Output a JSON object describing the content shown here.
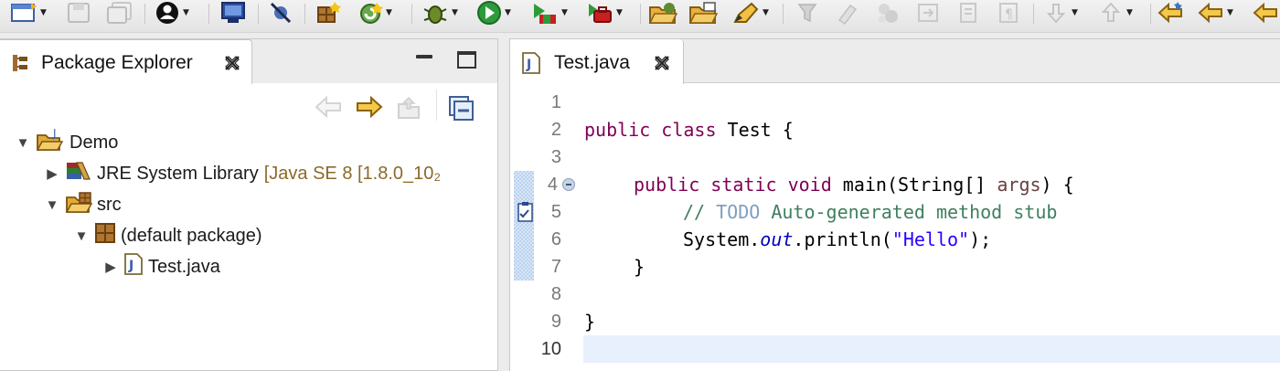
{
  "toolbar": {
    "icons": [
      "new-wizard-icon",
      "save-icon",
      "save-all-icon",
      "account-icon",
      "terminal-icon",
      "skip-breakpoints-icon",
      "new-package-icon",
      "refresh-icon",
      "debug-bug-icon",
      "run-play-icon",
      "run-coverage-icon",
      "external-tools-icon",
      "open-folder-icon",
      "open-type-icon",
      "highlight-pen-icon",
      "toggle-mark-icon",
      "search-tool-icon",
      "annotation-icon",
      "next-annotation-icon",
      "prev-annotation-icon",
      "last-edit-icon",
      "back-icon",
      "forward-icon"
    ]
  },
  "package_explorer": {
    "title": "Package Explorer",
    "tree": [
      {
        "label": "Demo",
        "expanded": true,
        "icon": "java-project-icon"
      },
      {
        "label": "JRE System Library",
        "decoration": "[Java SE 8 [1.8.0_10₂",
        "expanded": false,
        "icon": "library-icon"
      },
      {
        "label": "src",
        "expanded": true,
        "icon": "source-folder-icon"
      },
      {
        "label": "(default package)",
        "expanded": true,
        "icon": "package-icon"
      },
      {
        "label": "Test.java",
        "expanded": false,
        "icon": "java-file-icon"
      }
    ]
  },
  "editor": {
    "tab_title": "Test.java",
    "current_line": 10,
    "line_numbers": [
      "1",
      "2",
      "3",
      "4",
      "5",
      "6",
      "7",
      "8",
      "9",
      "10"
    ],
    "code": {
      "l2": {
        "kw": "public class",
        "rest": " Test {"
      },
      "l4": {
        "kw": "public static void",
        "sig": " main(String[] ",
        "param": "args",
        "end": ") {"
      },
      "l5": {
        "comment_start": "// ",
        "todo": "TODO",
        "comment_rest": " Auto-generated method stub"
      },
      "l6": {
        "pre": "System.",
        "field": "out",
        "mid": ".println(",
        "str": "\"Hello\"",
        "end": ");"
      },
      "l7": {
        "text": "}"
      },
      "l9": {
        "text": "}"
      }
    }
  }
}
